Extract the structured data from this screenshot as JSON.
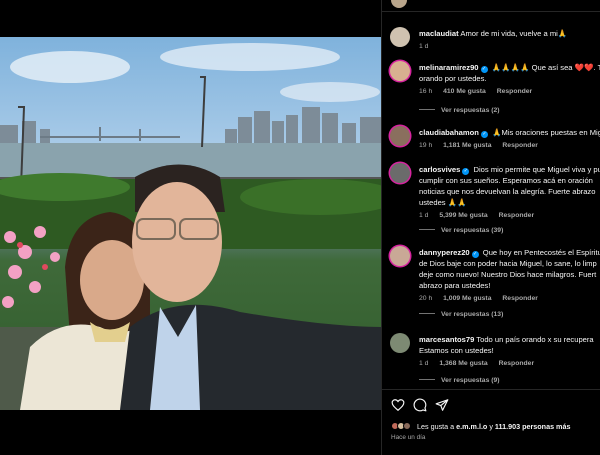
{
  "post": {
    "photo_alt": ""
  },
  "comments": [
    {
      "username": "maclaudiat",
      "verified": false,
      "text": "Amor de mi vida, vuelve a mi🙏",
      "time": "1 d",
      "likes": "",
      "reply_label": "",
      "view_replies": ""
    },
    {
      "username": "melinaramirez90",
      "verified": true,
      "text": "🙏🙏🙏🙏 Que así sea ❤️❤️. Todos",
      "text2": "orando por ustedes.",
      "time": "16 h",
      "likes": "410 Me gusta",
      "reply_label": "Responder",
      "view_replies": "Ver respuestas (2)"
    },
    {
      "username": "claudiabahamon",
      "verified": true,
      "text": "🙏Mis oraciones puestas en Mig",
      "time": "19 h",
      "likes": "1,181 Me gusta",
      "reply_label": "Responder",
      "view_replies": ""
    },
    {
      "username": "carlosvives",
      "verified": true,
      "text": "Dios mio permite que Miguel viva y pu",
      "text2": "cumplir con sus sueños. Esperamos acá en oración",
      "text3": "noticias que nos devuelvan la alegría. Fuerte abrazo",
      "text4": "ustedes 🙏🙏",
      "time": "1 d",
      "likes": "5,399 Me gusta",
      "reply_label": "Responder",
      "view_replies": "Ver respuestas (39)"
    },
    {
      "username": "dannyperez20",
      "verified": true,
      "text": "Que hoy en Pentecostés el Espíritu",
      "text2": "de Dios baje con poder hacia Miguel, lo sane, lo limp",
      "text3": "deje como nuevo! Nuestro Dios hace milagros. Fuert",
      "text4": "abrazo para ustedes!",
      "time": "20 h",
      "likes": "1,009 Me gusta",
      "reply_label": "Responder",
      "view_replies": "Ver respuestas (13)"
    },
    {
      "username": "marcesantos79",
      "verified": false,
      "text": "Todo un país orando x su recupera",
      "text2": "Estamos con ustedes!",
      "time": "1 d",
      "likes": "1,368 Me gusta",
      "reply_label": "Responder",
      "view_replies": "Ver respuestas (9)"
    }
  ],
  "actions": {
    "like_icon": "heart-icon",
    "comment_icon": "comment-icon",
    "share_icon": "send-icon"
  },
  "likes_line": {
    "prefix": "Les gusta a ",
    "user": "e.m.m.l.o",
    "middle": " y ",
    "count": "111.903 personas más"
  },
  "posted": "Hace un día",
  "colors": {
    "background": "#000000",
    "muted_text": "#a8a8a8",
    "verified_blue": "#0095f6",
    "divider": "#262626"
  }
}
